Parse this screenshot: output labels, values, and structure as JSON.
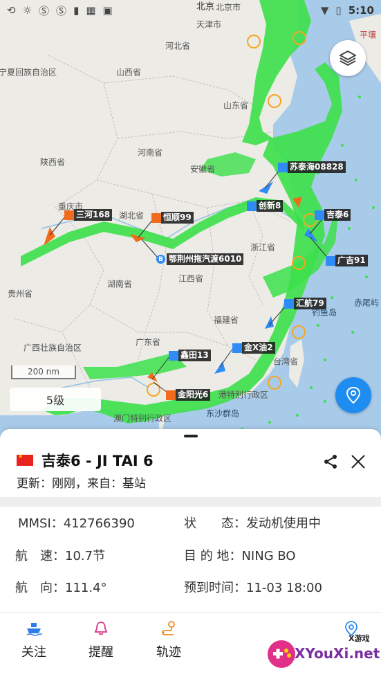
{
  "status_bar": {
    "time": "5:10",
    "left_icons": [
      "sync-icon",
      "brightness-icon",
      "s-app-icon",
      "s-app-icon-2",
      "clipboard-icon",
      "grid-icon",
      "inbox-icon"
    ],
    "right_icons": [
      "wifi-icon",
      "battery-icon"
    ]
  },
  "map": {
    "places": [
      {
        "name": "北京",
        "id": "beijing"
      },
      {
        "name": "北京市",
        "id": "beijing-shi"
      },
      {
        "name": "天津市",
        "id": "tianjin"
      },
      {
        "name": "河北省",
        "id": "hebei"
      },
      {
        "name": "宁夏回族自治区",
        "id": "ningxia"
      },
      {
        "name": "山西省",
        "id": "shanxi"
      },
      {
        "name": "山东省",
        "id": "shandong"
      },
      {
        "name": "河南省",
        "id": "henan"
      },
      {
        "name": "陕西省",
        "id": "shaanxi"
      },
      {
        "name": "安徽省",
        "id": "anhui"
      },
      {
        "name": "湖北省",
        "id": "hubei"
      },
      {
        "name": "重庆市",
        "id": "chongqing"
      },
      {
        "name": "浙江省",
        "id": "zhejiang"
      },
      {
        "name": "江西省",
        "id": "jiangxi"
      },
      {
        "name": "湖南省",
        "id": "hunan"
      },
      {
        "name": "贵州省",
        "id": "guizhou"
      },
      {
        "name": "福建省",
        "id": "fujian"
      },
      {
        "name": "广西壮族自治区",
        "id": "guangxi"
      },
      {
        "name": "广东省",
        "id": "guangdong"
      },
      {
        "name": "台湾省",
        "id": "taiwan"
      },
      {
        "name": "港特别行政区",
        "id": "hongkong"
      },
      {
        "name": "澳门特别行政区",
        "id": "macau"
      },
      {
        "name": "东沙群岛",
        "id": "dongsha"
      },
      {
        "name": "钓鱼岛",
        "id": "diaoyu"
      },
      {
        "name": "赤尾屿",
        "id": "chiwei"
      },
      {
        "name": "平壤",
        "id": "pyongyang"
      }
    ],
    "vessels": [
      {
        "name": "苏泰海08828",
        "color": "blue"
      },
      {
        "name": "创新8",
        "color": "blue"
      },
      {
        "name": "吉泰6",
        "color": "blue"
      },
      {
        "name": "三河168",
        "color": "orange"
      },
      {
        "name": "恒顺99",
        "color": "orange"
      },
      {
        "name": "鄂荆州拖汽渡6010",
        "color": "plain"
      },
      {
        "name": "广吉91",
        "color": "blue"
      },
      {
        "name": "汇航79",
        "color": "blue"
      },
      {
        "name": "金X油2",
        "color": "blue"
      },
      {
        "name": "鑫田13",
        "color": "blue"
      },
      {
        "name": "金阳光6",
        "color": "orange"
      }
    ],
    "scale_label": "200 nm",
    "zoom_label": "5级",
    "layer_button": "layers-icon",
    "locate_button": "location-pin-icon"
  },
  "vessel_panel": {
    "name": "吉泰6 - JI TAI 6",
    "update": "更新：刚刚，来自：基站",
    "flag": "china-flag",
    "fields": {
      "mmsi_label": "MMSI：",
      "mmsi_value": "412766390",
      "status_label": "状　　态：",
      "status_value": "发动机使用中",
      "speed_label": "航　速：",
      "speed_value": "10.7节",
      "dest_label": "目 的 地：",
      "dest_value": "NING BO",
      "course_label": "航　向：",
      "course_value": "111.4°",
      "eta_label": "预到时间：",
      "eta_value": "11-03 18:00"
    }
  },
  "tabs": [
    {
      "label": "关注",
      "icon": "ship-icon",
      "color": "#2f7de8"
    },
    {
      "label": "提醒",
      "icon": "bell-icon",
      "color": "#e0308a"
    },
    {
      "label": "轨迹",
      "icon": "track-icon",
      "color": "#f08a20"
    },
    {
      "label": "",
      "icon": "location-pin-icon",
      "color": "#2f8bf5"
    }
  ],
  "watermark": {
    "text": "XYouXi.net",
    "small": "X游戏"
  }
}
